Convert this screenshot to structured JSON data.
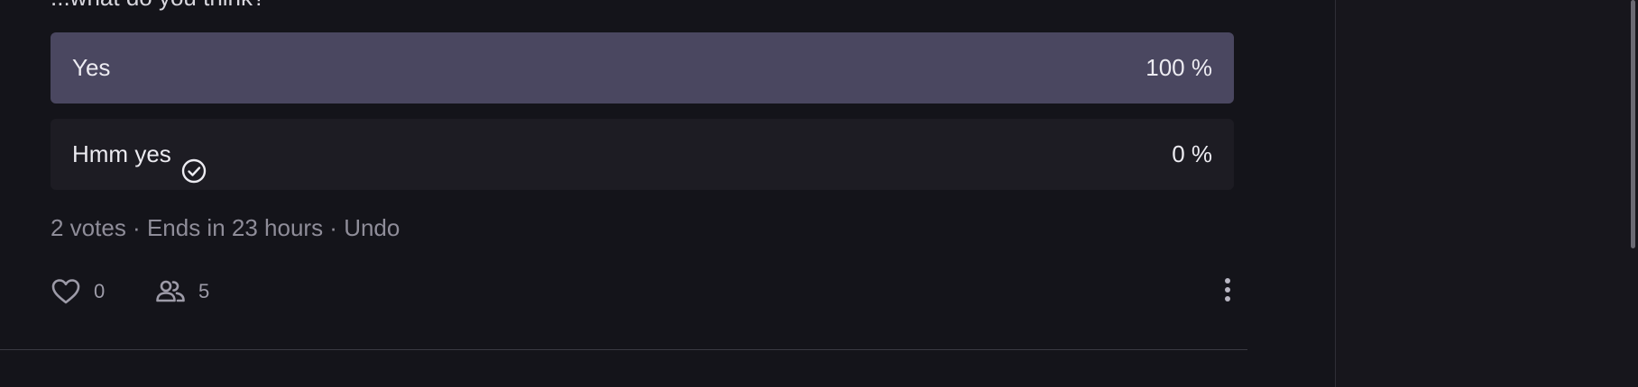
{
  "partial_header": "...what do you think?",
  "poll": {
    "options": [
      {
        "label": "Yes",
        "percent_text": "100 %",
        "percent": 100,
        "voted": false
      },
      {
        "label": "Hmm yes",
        "percent_text": "0 %",
        "percent": 0,
        "voted": true
      }
    ],
    "votes": "2 votes",
    "ends": "Ends in 23 hours",
    "undo": "Undo",
    "separator": " · "
  },
  "actions": {
    "like_count": "0",
    "participants_count": "5"
  },
  "icons": {
    "voted": "check-circle-icon",
    "like": "heart-icon",
    "participants": "people-icon",
    "more": "vertical-dots-icon"
  },
  "colors": {
    "background": "#14141a",
    "bar_fill": "#4a4760",
    "option_bg": "#1d1c23",
    "muted_text": "#8f8d99"
  }
}
